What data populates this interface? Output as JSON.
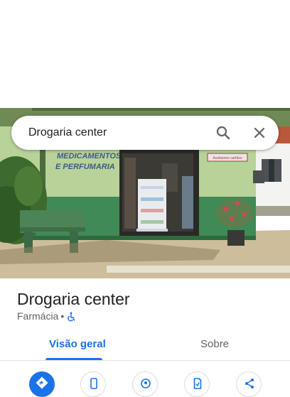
{
  "search": {
    "value": "Drogaria center"
  },
  "hero": {
    "sign_line1": "MEDICAMENTOS",
    "sign_line2": "E PERFUMARIA",
    "door_sign": "Aceitamos cartões"
  },
  "place": {
    "title": "Drogaria center",
    "category": "Farmácia",
    "separator": "•",
    "accessibility_icon": "wheelchair-icon"
  },
  "tabs": [
    {
      "label": "Visão geral",
      "active": true
    },
    {
      "label": "Sobre",
      "active": false
    }
  ],
  "actions": [
    {
      "icon": "directions-icon"
    },
    {
      "icon": "phone-icon"
    },
    {
      "icon": "location-icon"
    },
    {
      "icon": "save-icon"
    },
    {
      "icon": "share-icon"
    }
  ],
  "colors": {
    "accent": "#1a73e8",
    "text_primary": "#202124",
    "text_secondary": "#5f6368"
  }
}
